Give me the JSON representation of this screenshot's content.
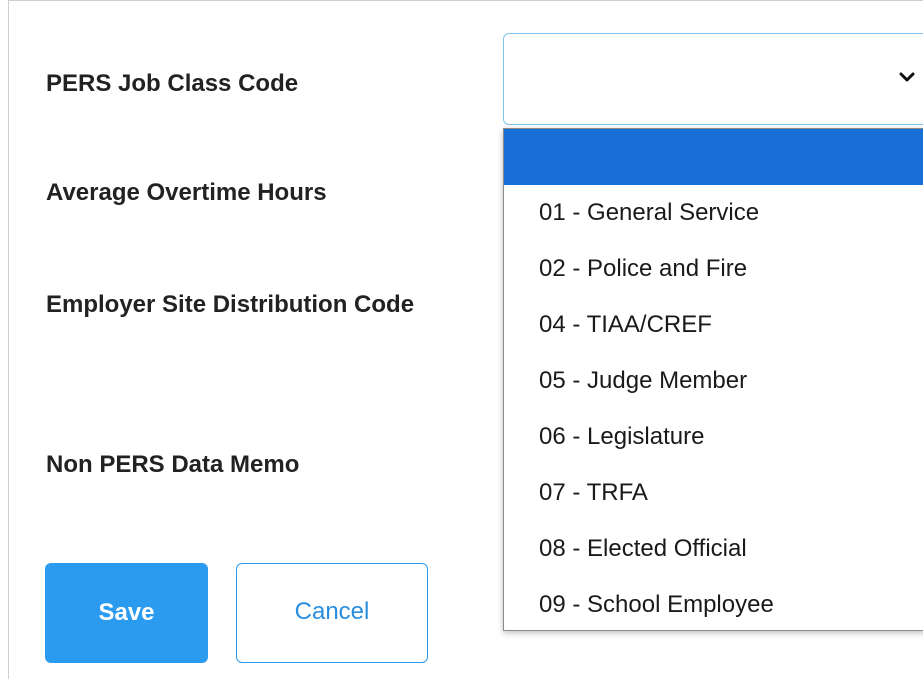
{
  "form": {
    "fields": [
      {
        "label": "PERS Job Class Code"
      },
      {
        "label": "Average Overtime Hours"
      },
      {
        "label": "Employer Site Distribution Code"
      },
      {
        "label": "Non PERS Data Memo"
      }
    ]
  },
  "job_class_select": {
    "selected_value": "",
    "icon": "chevron-down-icon",
    "options": [
      "",
      "01 - General Service",
      "02 - Police and Fire",
      "04 - TIAA/CREF",
      "05 - Judge Member",
      "06 - Legislature",
      "07 - TRFA",
      "08 - Elected Official",
      "09 - School Employee"
    ]
  },
  "buttons": {
    "save_label": "Save",
    "cancel_label": "Cancel"
  },
  "colors": {
    "accent": "#2a9bef",
    "selected_option": "#1a6fd6",
    "select_border": "#7fc6ef"
  }
}
